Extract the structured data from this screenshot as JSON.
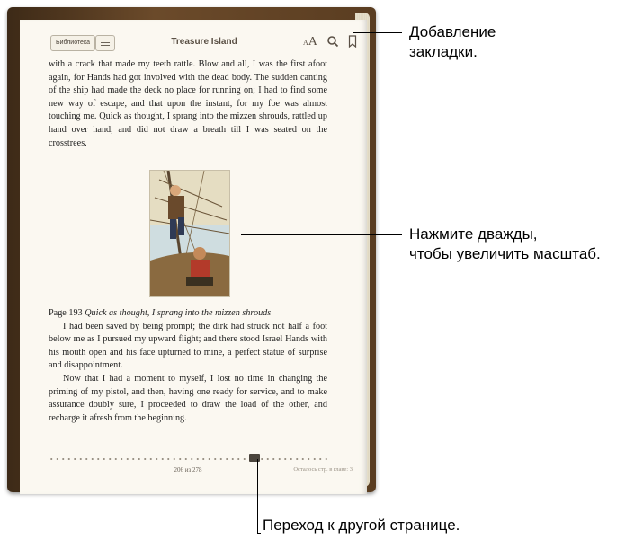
{
  "toolbar": {
    "library_label": "Библиотека",
    "book_title": "Treasure Island",
    "font_small": "A",
    "font_big": "A"
  },
  "content": {
    "para1": "with a crack that made my teeth rattle. Blow and all, I was the first afoot again, for Hands had got involved with the dead body. The sudden canting of the ship had made the deck no place for running on; I had to find some new way of escape, and that upon the instant, for my foe was almost touching me. Quick as thought, I sprang into the mizzen shrouds, rattled up hand over hand, and did not draw a breath till I was seated on the crosstrees.",
    "caption_prefix": "Page 193 ",
    "caption_italic": "Quick as thought, I sprang into the mizzen shrouds",
    "para2": "I had been saved by being prompt; the dirk had struck not half a foot below me as I pursued my upward flight; and there stood Israel Hands with his mouth open and his face upturned to mine, a perfect statue of surprise and disappointment.",
    "para3": "Now that I had a moment to myself, I lost no time in changing the priming of my pistol, and then, having one ready for service, and to make assurance doubly sure, I proceeded to draw the load of the other, and recharge it afresh from the beginning."
  },
  "footer": {
    "page_indicator": "206 из 278",
    "remaining": "Осталось стр. в главе: 3",
    "progress_fraction": 0.74
  },
  "callouts": {
    "bookmark": "Добавление закладки.",
    "zoom_line1": "Нажмите дважды,",
    "zoom_line2": "чтобы увеличить масштаб.",
    "navigate": "Переход к другой странице."
  },
  "icons": {
    "toc": "list-icon",
    "search": "search-icon",
    "bookmark": "bookmark-icon",
    "font": "font-size-icon"
  }
}
